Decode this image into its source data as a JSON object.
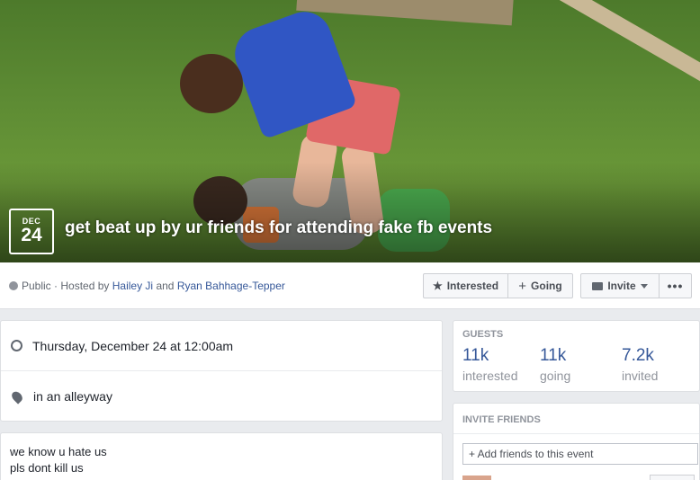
{
  "event": {
    "month": "DEC",
    "day": "24",
    "title": "get beat up by ur friends for attending fake fb events",
    "privacy": "Public",
    "hosted_by_prefix": "Hosted by",
    "host1": "Hailey Ji",
    "and": "and",
    "host2": "Ryan Bahhage-Tepper"
  },
  "actions": {
    "interested": "Interested",
    "going": "Going",
    "invite": "Invite",
    "more": "•••"
  },
  "details": {
    "datetime": "Thursday, December 24 at 12:00am",
    "location": "in an alleyway",
    "description_line1": "we know u hate us",
    "description_line2": "pls dont kill us"
  },
  "guests": {
    "title": "GUESTS",
    "interested_count": "11k",
    "interested_label": "interested",
    "going_count": "11k",
    "going_label": "going",
    "invited_count": "7.2k",
    "invited_label": "invited"
  },
  "invite_friends": {
    "title": "INVITE FRIENDS",
    "placeholder": "+ Add friends to this event"
  },
  "colors": {
    "link": "#365899",
    "muted": "#90949c",
    "background": "#e9ebee"
  },
  "icons": [
    "globe-icon",
    "star-icon",
    "plus-icon",
    "mail-icon",
    "caret-down-icon",
    "more-icon",
    "clock-icon",
    "pin-icon"
  ]
}
